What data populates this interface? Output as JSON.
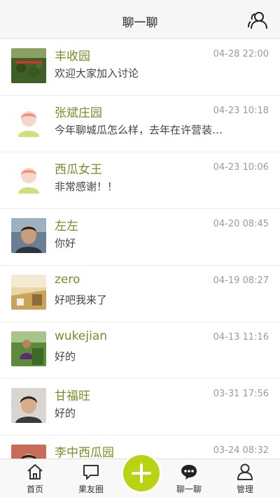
{
  "header": {
    "title": "聊一聊",
    "contacts_icon": "contacts-icon"
  },
  "chats": [
    {
      "name": "丰收园",
      "time": "04-28 22:00",
      "message": "欢迎大家加入讨论",
      "avatar": "watermelon-field-photo"
    },
    {
      "name": "张斌庄园",
      "time": "04-23 10:18",
      "message": "今年聊城瓜怎么样，去年在许营装…",
      "avatar": "default-avatar"
    },
    {
      "name": "西瓜女王",
      "time": "04-23 10:06",
      "message": "非常感谢！！",
      "avatar": "default-avatar"
    },
    {
      "name": "左左",
      "time": "04-20 08:45",
      "message": "你好",
      "avatar": "man-portrait-photo"
    },
    {
      "name": "zero",
      "time": "04-19 08:27",
      "message": "好吧我来了",
      "avatar": "wheat-field-photo"
    },
    {
      "name": "wukejian",
      "time": "04-13 11:16",
      "message": "好的",
      "avatar": "man-in-field-photo"
    },
    {
      "name": "甘福旺",
      "time": "03-31 17:56",
      "message": "好的",
      "avatar": "man-portrait-photo-2"
    },
    {
      "name": "李中西瓜园",
      "time": "03-24 08:32",
      "message": "",
      "avatar": "man-portrait-photo-3"
    }
  ],
  "tabbar": {
    "tabs": [
      {
        "label": "首页",
        "icon": "home-icon"
      },
      {
        "label": "果友圈",
        "icon": "chat-bubble-icon"
      },
      {
        "label": "",
        "icon": "plus-icon"
      },
      {
        "label": "聊一聊",
        "icon": "message-dots-icon",
        "active": true
      },
      {
        "label": "管理",
        "icon": "person-icon"
      }
    ]
  },
  "colors": {
    "accent": "#b9d211",
    "name": "#7a8c2a",
    "time": "#9a9a9a",
    "header_bg": "#f6f6f6"
  }
}
